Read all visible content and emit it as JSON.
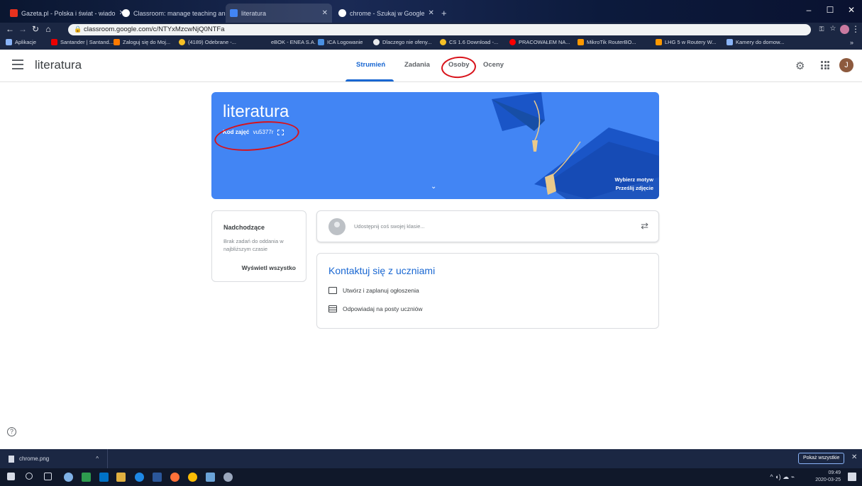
{
  "browser": {
    "tabs": [
      {
        "title": "Gazeta.pl - Polska i świat - wiado",
        "color": "#e8321e"
      },
      {
        "title": "Classroom: manage teaching an",
        "color": "#ffffff"
      },
      {
        "title": "literatura",
        "color": "#4285f4",
        "active": true
      },
      {
        "title": "chrome - Szukaj w Google",
        "color": "#ffffff"
      }
    ],
    "new_tab": "+",
    "url": "classroom.google.com/c/NTYxMzcwNjQ0NTFa",
    "bookmarks": [
      "Aplikacje",
      "Santander | Santand...",
      "Zaloguj się do Moj...",
      "(4189) Odebrane -...",
      "eBOK - ENEA S.A.",
      "ICA Logowanie",
      "Dlaczego nie ofeny...",
      "CS 1.6 Download -...",
      "PRACOWAŁEM NA...",
      "MikroTik RouterBO...",
      "LHG 5 w Routery W...",
      "Kamery do domow..."
    ]
  },
  "header": {
    "class_name": "literatura",
    "tabs": [
      "Strumień",
      "Zadania",
      "Osoby",
      "Oceny"
    ]
  },
  "banner": {
    "title": "literatura",
    "code_label": "Kod zajęć",
    "code_value": "vu5377r",
    "theme_link": "Wybierz motyw",
    "upload_link": "Prześlij zdjęcie",
    "color": "#4285f4"
  },
  "upcoming": {
    "title": "Nadchodzące",
    "empty": "Brak zadań do oddania w najbliższym czasie",
    "view_all": "Wyświetl wszystko"
  },
  "share": {
    "placeholder": "Udostępnij coś swojej klasie..."
  },
  "contact": {
    "title": "Kontaktuj się z uczniami",
    "items": [
      "Utwórz i zaplanuj ogłoszenia",
      "Odpowiadaj na posty uczniów"
    ]
  },
  "user": {
    "initial": "J"
  },
  "downloads": {
    "file": "chrome.png",
    "show_all": "Pokaż wszystkie"
  },
  "taskbar": {
    "time": "09:49",
    "date": "2020-03-25"
  },
  "annotation_color": "#d8121a"
}
